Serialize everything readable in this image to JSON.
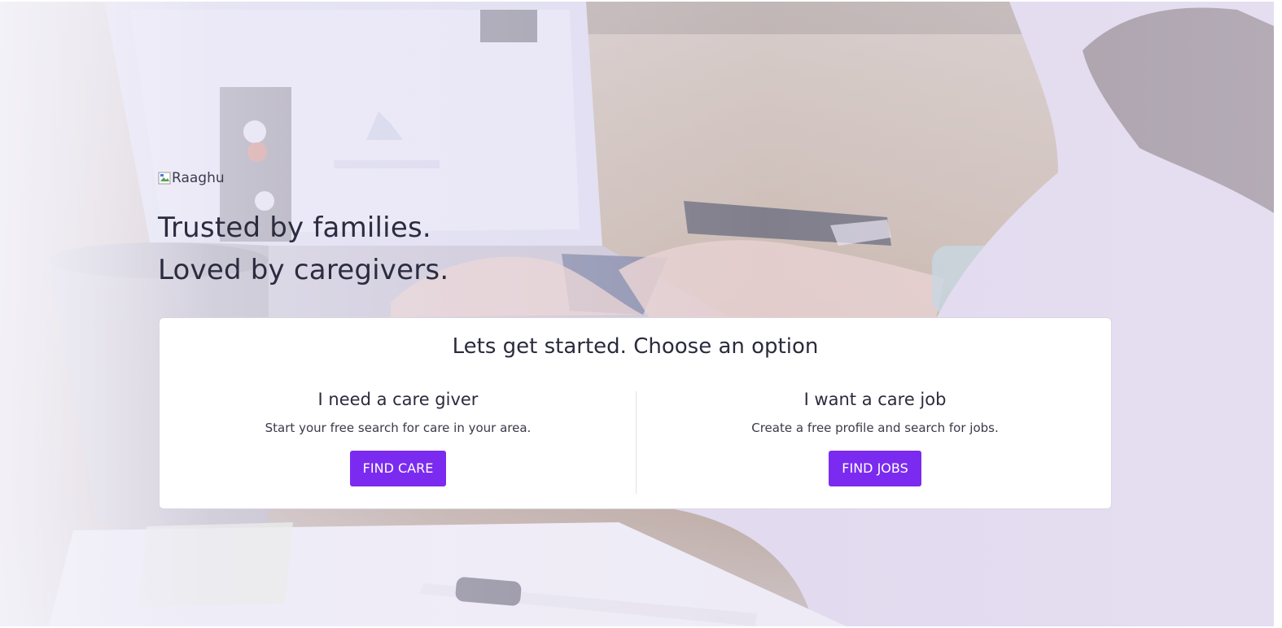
{
  "logo": {
    "alt_text": "Raaghu"
  },
  "hero": {
    "line1": "Trusted by families.",
    "line2": "Loved by caregivers."
  },
  "card": {
    "title": "Lets get started. Choose an option",
    "options": [
      {
        "heading": "I need a care giver",
        "description": "Start your free search for care in your area.",
        "button": "FIND CARE"
      },
      {
        "heading": "I want a care job",
        "description": "Create a free profile and search for jobs.",
        "button": "FIND JOBS"
      }
    ]
  },
  "colors": {
    "accent": "#7b2bf0",
    "text_dark": "#2c2c40",
    "card_bg": "#ffffff"
  },
  "icons": {
    "broken_image": "broken-image-icon"
  }
}
